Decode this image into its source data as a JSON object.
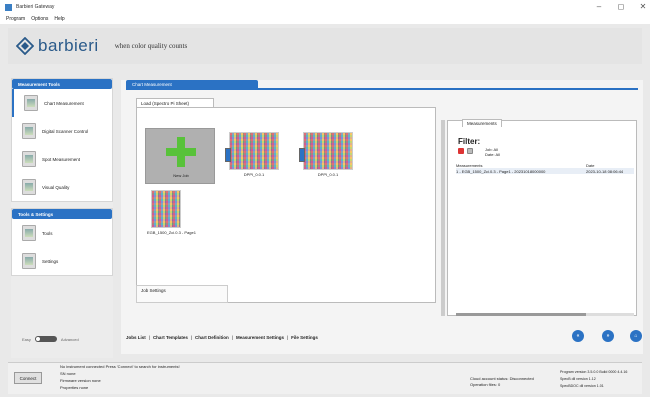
{
  "window": {
    "title": "Barbieri Gateway",
    "controls": [
      "–",
      "◻",
      "✕"
    ]
  },
  "menu": [
    "Program",
    "Options",
    "Help"
  ],
  "header": {
    "brand": "barbieri",
    "tagline": "when color quality counts"
  },
  "sidebar": {
    "measurement_head": "Measurement Tools",
    "measurement_items": [
      "Chart Measurement",
      "Digital Scanner Control",
      "Spot Measurement",
      "Visual Quality"
    ],
    "tools_head": "Tools & Settings",
    "tools_items": [
      "Tools",
      "Settings"
    ],
    "toggle_left": "Easy",
    "toggle_right": "Advanced"
  },
  "main": {
    "tab": "Chart Measurement",
    "subtab": "Load (Spectro Pi Sheet)",
    "cards": [
      {
        "label": "New Job"
      },
      {
        "label": "DPPI_0.0.1"
      },
      {
        "label": "DPPI_0.0.1"
      },
      {
        "label": "EGB_1500_Zci.0.3 - Page1"
      }
    ],
    "job_settings": "Job Settings",
    "measurements_tab": "Measurements",
    "filter_title": "Filter:",
    "filter_options": [
      "Job: All",
      "Date: All"
    ],
    "table_headers": [
      "Measurements",
      "Date"
    ],
    "table_rows": [
      {
        "name": "1 - EGB_1500_Zci.0.3 - Page1 - 20231018000000",
        "date": "2023-10-18 08:06:44"
      }
    ],
    "bottom_links": [
      "Jobs List",
      "Chart Templates",
      "Chart Definition",
      "Measurement Settings",
      "File Settings"
    ],
    "nav_buttons": [
      "«",
      "»",
      "⌂"
    ]
  },
  "status": {
    "connect": "Connect",
    "line1": "No instrument connected   Press 'Connect' to search for instruments!",
    "line2": "SN   none",
    "line3": "Firmware version   none",
    "line4": "Properties   none",
    "right_a": "Cloud account status: Disconnected",
    "right_b": "Operation files: 0",
    "version_program": "Program version   3.5.0.0 Build 0000 4.4.16",
    "version_specb": "SpecB dll version   1.12",
    "version_specbdoc": "SpecBDOC dll version   1.01"
  },
  "colors": {
    "accent": "#2b72c4",
    "plus": "#58c23a"
  }
}
